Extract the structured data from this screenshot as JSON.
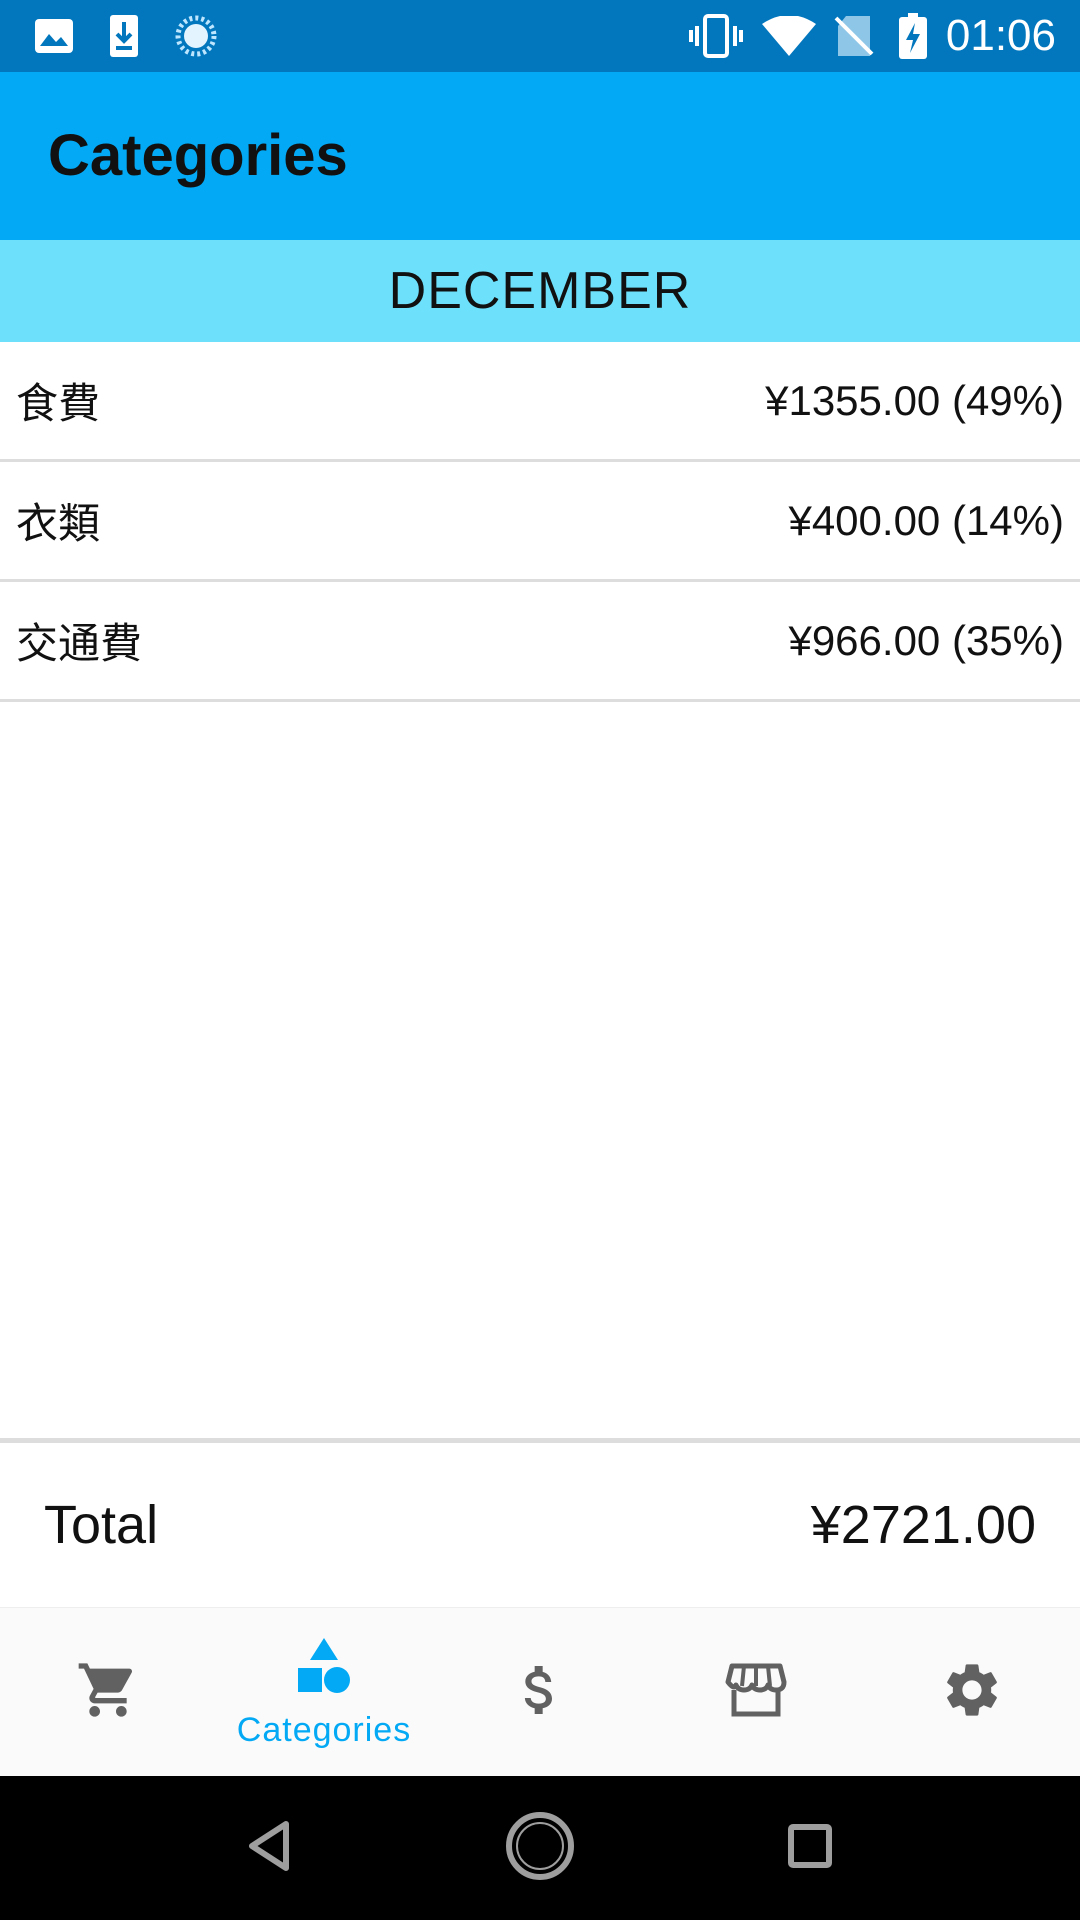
{
  "status_bar": {
    "time": "01:06",
    "left_icons": [
      "image-icon",
      "download-icon",
      "sync-icon"
    ],
    "right_icons": [
      "vibrate-icon",
      "wifi-icon",
      "no-sim-icon",
      "battery-charging-icon"
    ]
  },
  "app_bar": {
    "title": "Categories"
  },
  "month": {
    "label": "DECEMBER"
  },
  "categories": [
    {
      "name": "食費",
      "amount": "¥1355.00 (49%)"
    },
    {
      "name": "衣類",
      "amount": "¥400.00 (14%)"
    },
    {
      "name": "交通費",
      "amount": "¥966.00 (35%)"
    }
  ],
  "total": {
    "label": "Total",
    "value": "¥2721.00"
  },
  "bottom_nav": {
    "items": [
      {
        "icon": "cart-icon",
        "label": ""
      },
      {
        "icon": "categories-icon",
        "label": "Categories",
        "active": true
      },
      {
        "icon": "dollar-icon",
        "label": ""
      },
      {
        "icon": "store-icon",
        "label": ""
      },
      {
        "icon": "settings-icon",
        "label": ""
      }
    ]
  },
  "colors": {
    "status_bar": "#0277bd",
    "app_bar": "#03a9f4",
    "month_header": "#6de0fc",
    "active_nav": "#03a9f4",
    "inactive_nav": "#616161"
  }
}
